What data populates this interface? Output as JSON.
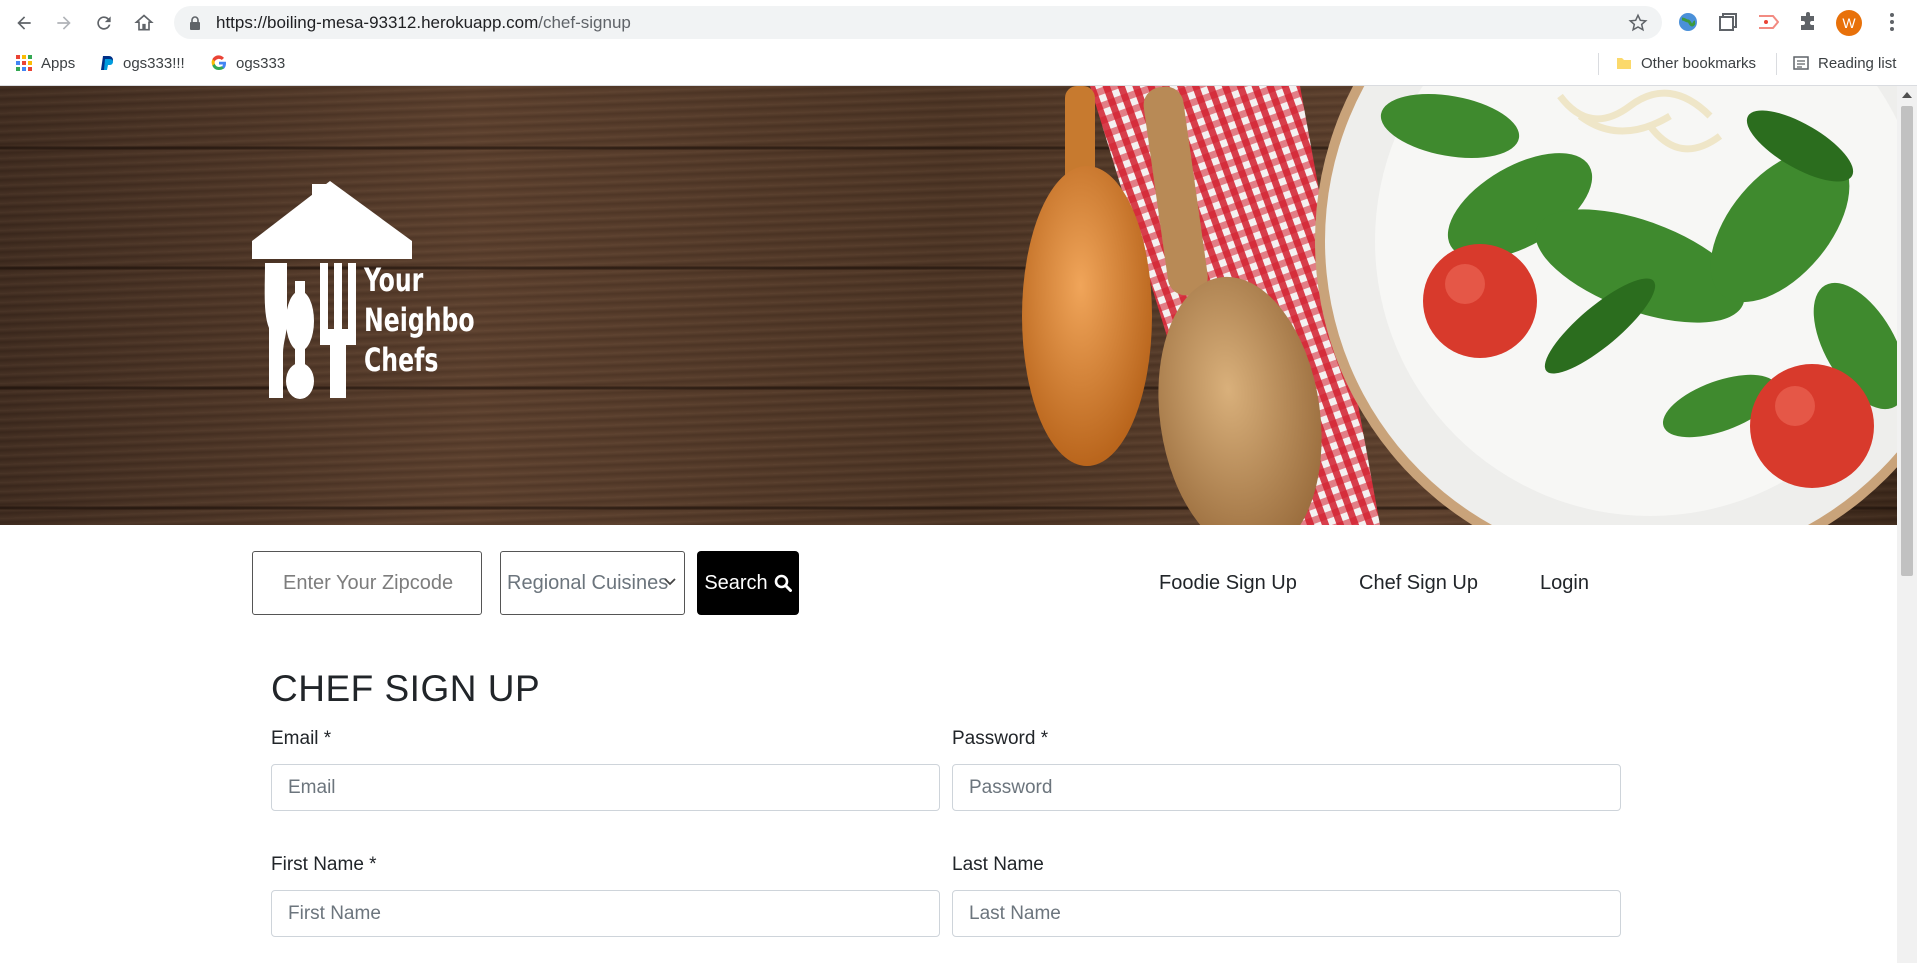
{
  "browser": {
    "url_host": "https://boiling-mesa-93312.herokuapp.com",
    "url_path": "/chef-signup",
    "profile_initial": "W",
    "bookmarks": [
      {
        "label": "Apps",
        "icon": "apps-grid-icon"
      },
      {
        "label": "ogs333!!!",
        "icon": "paypal-icon"
      },
      {
        "label": "ogs333",
        "icon": "google-icon"
      }
    ],
    "other_bookmarks": "Other bookmarks",
    "reading_list": "Reading list"
  },
  "site": {
    "logo_text": [
      "Your",
      "Neighbor",
      "Chefs"
    ]
  },
  "search": {
    "zip_placeholder": "Enter Your Zipcode",
    "cuisine_selected": "Regional Cuisines",
    "button_label": "Search"
  },
  "nav": {
    "foodie_signup": "Foodie Sign Up",
    "chef_signup": "Chef Sign Up",
    "login": "Login"
  },
  "form": {
    "title": "CHEF SIGN UP",
    "email_label": "Email *",
    "email_placeholder": "Email",
    "password_label": "Password *",
    "password_placeholder": "Password",
    "first_name_label": "First Name *",
    "first_name_placeholder": "First Name",
    "last_name_label": "Last Name",
    "last_name_placeholder": "Last Name"
  },
  "colors": {
    "search_button": "#000000",
    "profile_avatar": "#e8710a"
  }
}
